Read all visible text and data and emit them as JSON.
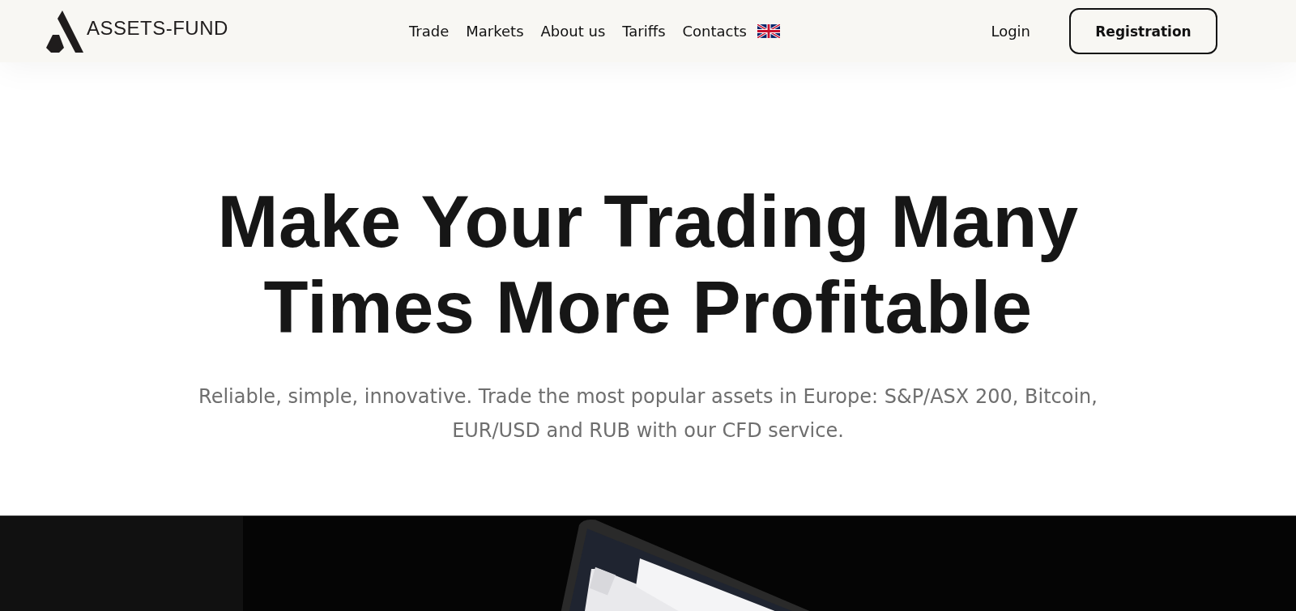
{
  "header": {
    "logo_text": "ASSETS-FUND",
    "nav": [
      {
        "label": "Trade"
      },
      {
        "label": "Markets"
      },
      {
        "label": "About us"
      },
      {
        "label": "Tariffs"
      },
      {
        "label": "Contacts"
      }
    ],
    "login": "Login",
    "registration": "Registration"
  },
  "hero": {
    "title_lines": [
      "Make Your Trading Many",
      "Times More Profitable"
    ],
    "subtitle": "Reliable, simple, innovative. Trade the most popular assets in Europe: S&P/ASX 200, Bitcoin, EUR/USD and RUB with our CFD service."
  }
}
